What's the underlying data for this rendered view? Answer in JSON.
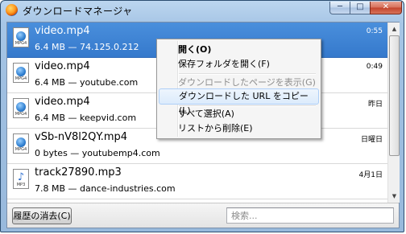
{
  "window": {
    "title": "ダウンロードマネージャ",
    "minimize_glyph": "─",
    "maximize_glyph": "□",
    "close_glyph": "✕"
  },
  "downloads": [
    {
      "name": "video.mp4",
      "info": "6.4 MB — 74.125.0.212",
      "time": "0:55",
      "icon": "video-file-icon",
      "ext": "MPG4"
    },
    {
      "name": "video.mp4",
      "info": "6.4 MB — youtube.com",
      "time": "0:49",
      "icon": "video-file-icon",
      "ext": "MPG4"
    },
    {
      "name": "video.mp4",
      "info": "6.4 MB — keepvid.com",
      "time": "昨日",
      "icon": "video-file-icon",
      "ext": "MPG4"
    },
    {
      "name": "vSb-nV8l2QY.mp4",
      "info": "0 bytes — youtubemp4.com",
      "time": "日曜日",
      "icon": "video-file-icon",
      "ext": "MPG4"
    },
    {
      "name": "track27890.mp3",
      "info": "7.8 MB — dance-industries.com",
      "time": "4月1日",
      "icon": "audio-file-icon",
      "ext": "MP3"
    }
  ],
  "context_menu": {
    "open": "開く(O)",
    "open_folder": "保存フォルダを開く(F)",
    "go_to_page": "ダウンロードしたページを表示(G)",
    "copy_url": "ダウンロードした URL をコピー(L)",
    "select_all": "すべて選択(A)",
    "remove": "リストから削除(E)"
  },
  "bottom": {
    "clear_history": "履歴の消去(C)",
    "search_placeholder": "検索..."
  },
  "scrollbar": {
    "up_glyph": "▲",
    "down_glyph": "▼"
  }
}
